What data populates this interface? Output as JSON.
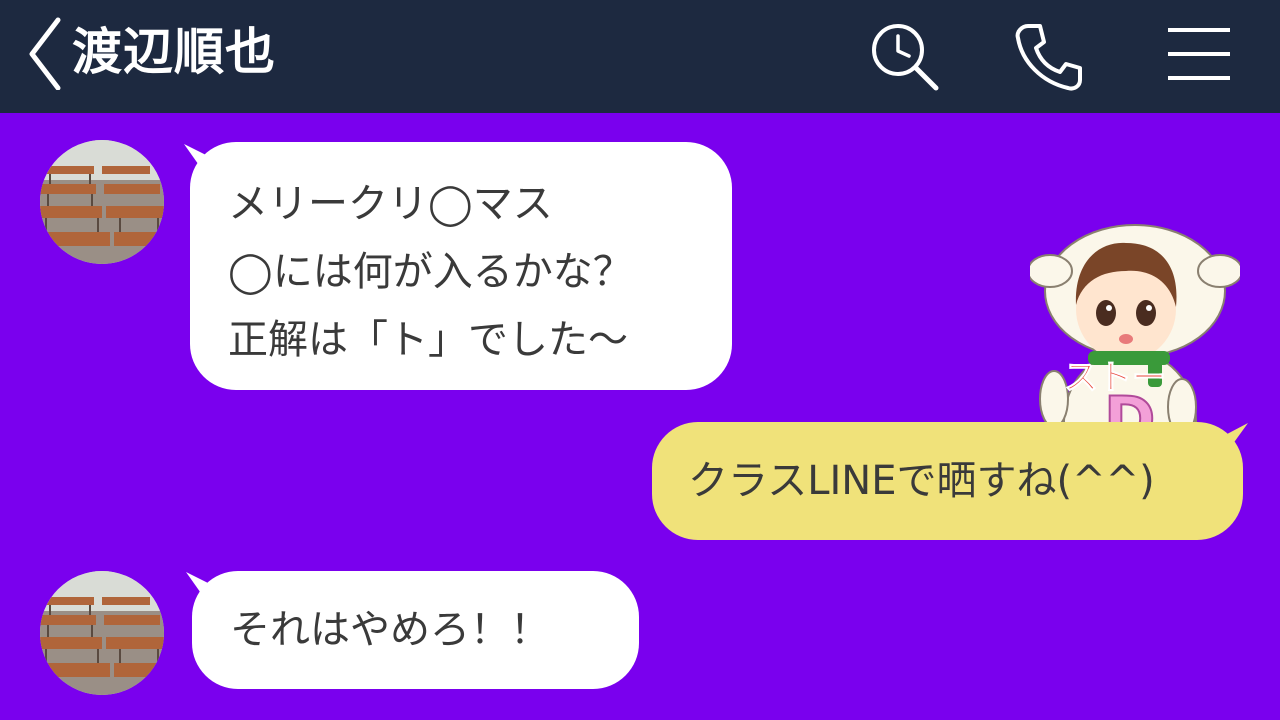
{
  "header": {
    "contact_name": "渡辺順也",
    "background": "#1d2940"
  },
  "chat": {
    "background": "#7a00ee",
    "messages": [
      {
        "from": "contact",
        "lines": [
          "メリークリ◯マス",
          "◯には何が入るかな？",
          "正解は「ト」でした〜"
        ]
      },
      {
        "from": "me",
        "lines": [
          "クラスLINEで晒すね(^^)"
        ]
      },
      {
        "from": "contact",
        "lines": [
          "それはやめろ！！"
        ]
      }
    ]
  },
  "sticker": {
    "text_top": "ストー",
    "text_letter": "D"
  },
  "colors": {
    "incoming_bubble": "#ffffff",
    "outgoing_bubble": "#f0e27a",
    "message_text": "#3a3a3a"
  },
  "icons": [
    "back-chevron-icon",
    "search-icon",
    "phone-icon",
    "menu-icon"
  ]
}
